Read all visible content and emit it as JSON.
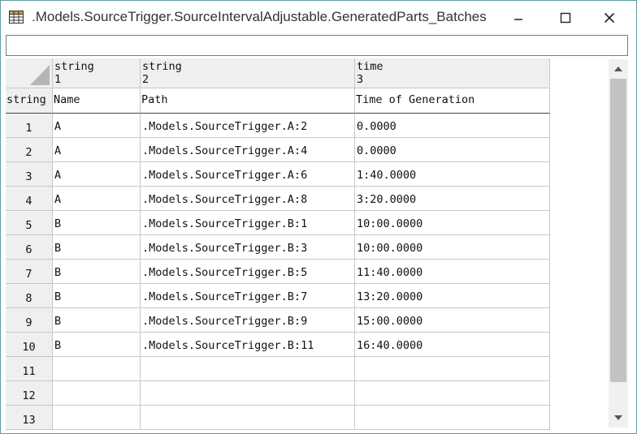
{
  "window": {
    "title": ".Models.SourceTrigger.SourceIntervalAdjustable.GeneratedParts_Batches",
    "input_value": ""
  },
  "columns": [
    {
      "type": "string",
      "index": "1",
      "name": "Name"
    },
    {
      "type": "string",
      "index": "2",
      "name": "Path"
    },
    {
      "type": "time",
      "index": "3",
      "name": "Time of Generation"
    }
  ],
  "row_header_type": "string",
  "rows": [
    {
      "num": "1",
      "cells": [
        "A",
        ".Models.SourceTrigger.A:2",
        "0.0000"
      ]
    },
    {
      "num": "2",
      "cells": [
        "A",
        ".Models.SourceTrigger.A:4",
        "0.0000"
      ]
    },
    {
      "num": "3",
      "cells": [
        "A",
        ".Models.SourceTrigger.A:6",
        "1:40.0000"
      ]
    },
    {
      "num": "4",
      "cells": [
        "A",
        ".Models.SourceTrigger.A:8",
        "3:20.0000"
      ]
    },
    {
      "num": "5",
      "cells": [
        "B",
        ".Models.SourceTrigger.B:1",
        "10:00.0000"
      ]
    },
    {
      "num": "6",
      "cells": [
        "B",
        ".Models.SourceTrigger.B:3",
        "10:00.0000"
      ]
    },
    {
      "num": "7",
      "cells": [
        "B",
        ".Models.SourceTrigger.B:5",
        "11:40.0000"
      ]
    },
    {
      "num": "8",
      "cells": [
        "B",
        ".Models.SourceTrigger.B:7",
        "13:20.0000"
      ]
    },
    {
      "num": "9",
      "cells": [
        "B",
        ".Models.SourceTrigger.B:9",
        "15:00.0000"
      ]
    },
    {
      "num": "10",
      "cells": [
        "B",
        ".Models.SourceTrigger.B:11",
        "16:40.0000"
      ]
    },
    {
      "num": "11",
      "cells": [
        "",
        "",
        ""
      ]
    },
    {
      "num": "12",
      "cells": [
        "",
        "",
        ""
      ]
    },
    {
      "num": "13",
      "cells": [
        "",
        "",
        ""
      ]
    }
  ],
  "icons": {
    "app": "table-icon",
    "minimize": "minimize-icon",
    "maximize": "maximize-icon",
    "close": "close-icon",
    "scroll_up": "scroll-up-arrow-icon",
    "scroll_down": "scroll-down-arrow-icon"
  },
  "colors": {
    "window_border": "#5f9ea0",
    "header_bg": "#efefef",
    "grid_line": "#c8c8c8",
    "scroll_thumb": "#c2c2c2"
  }
}
